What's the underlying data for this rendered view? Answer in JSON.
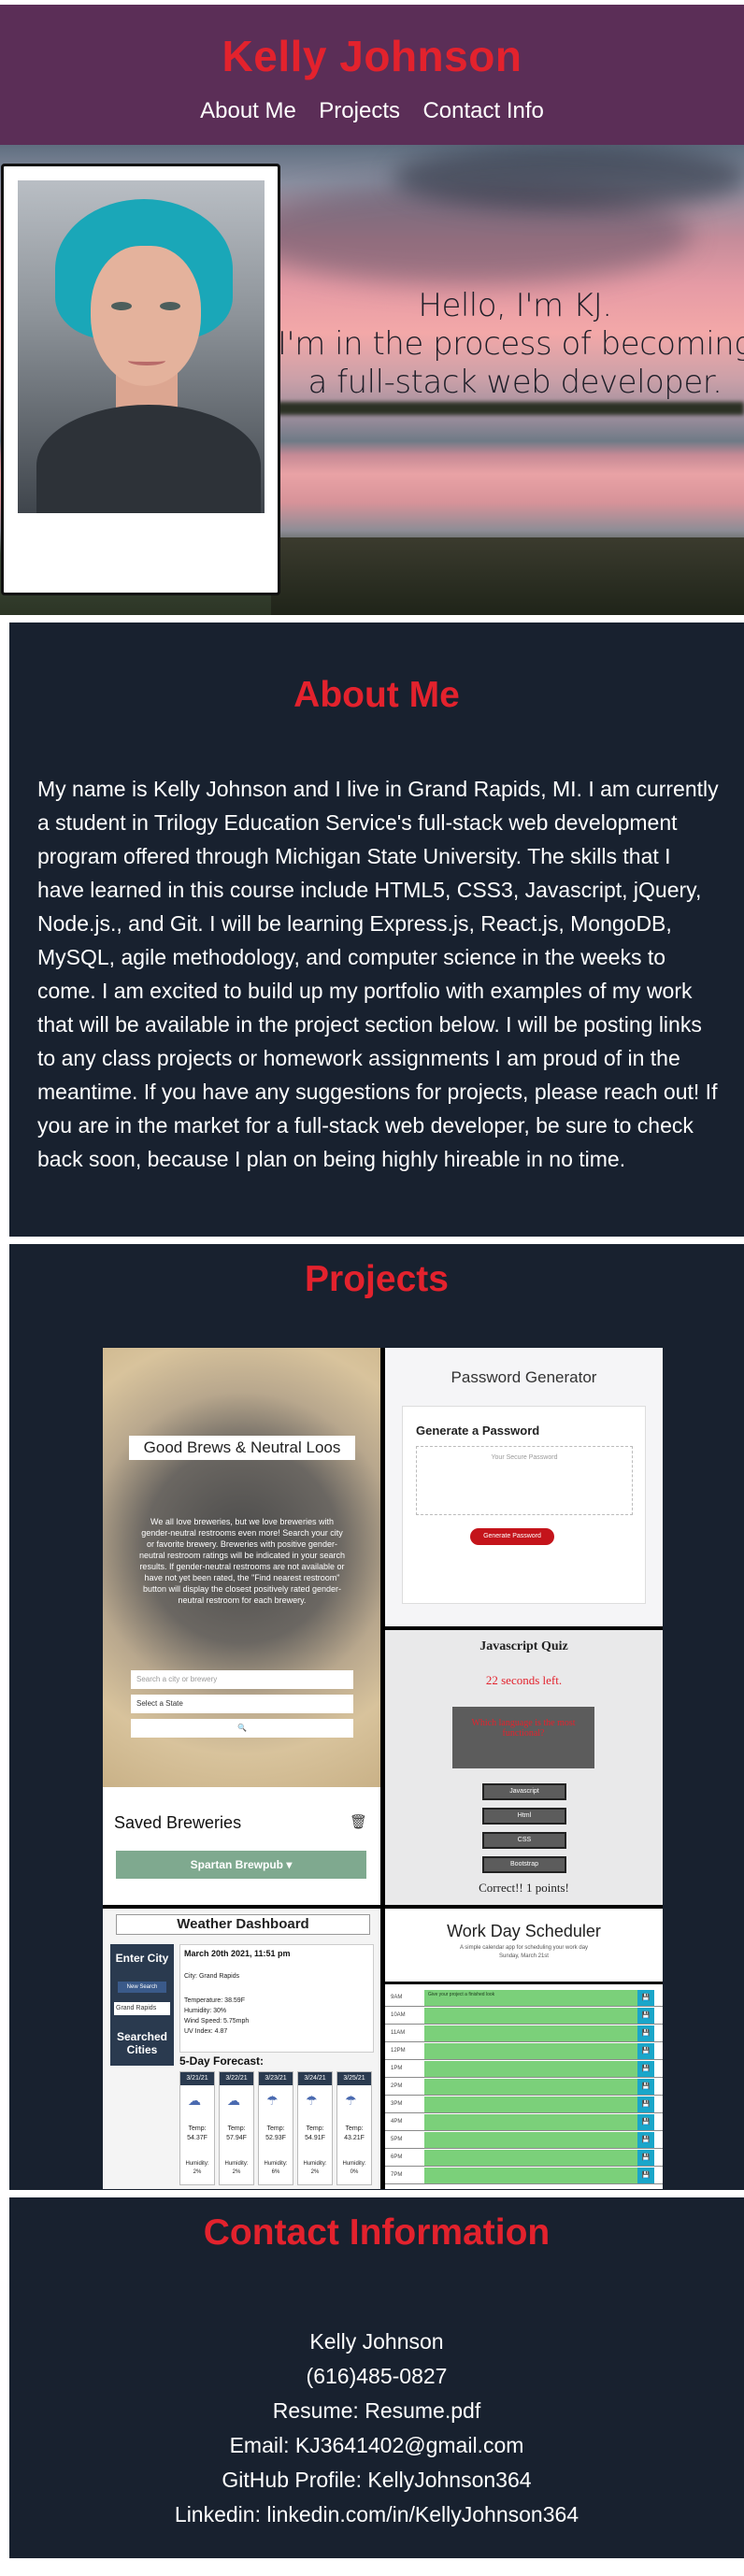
{
  "header": {
    "title": "Kelly Johnson",
    "nav": [
      "About Me",
      "Projects",
      "Contact Info"
    ]
  },
  "hero": {
    "line1": "Hello, I'm KJ.",
    "line2": "I'm in the process of becoming",
    "line3": "a full-stack web developer."
  },
  "about": {
    "title": "About Me",
    "text": "My name is Kelly Johnson and I live in Grand Rapids, MI. I am currently a student in Trilogy Education Service's full-stack web development program offered through Michigan State University. The skills that I have learned in this course include HTML5, CSS3, Javascript, jQuery, Node.js., and Git. I will be learning Express.js, React.js, MongoDB, MySQL, agile methodology, and computer science in the weeks to come. I am excited to build up my portfolio with examples of my work that will be available in the project section below. I will be posting links to any class projects or homework assignments I am proud of in the meantime. If you have any suggestions for projects, please reach out! If you are in the market for a full-stack web developer, be sure to check back soon, because I plan on being highly hireable in no time."
  },
  "projects": {
    "title": "Projects",
    "brewery": {
      "title": "Good Brews & Neutral Loos",
      "desc": "We all love breweries, but we love breweries with gender-neutral restrooms even more! Search your city or favorite brewery. Breweries with positive gender-neutral restroom ratings will be indicated in your search results. If gender-neutral restrooms are not available or have not yet been rated, the \"Find nearest restroom\" button will display the closest positively rated gender-neutral restroom for each brewery.",
      "search_placeholder": "Search a city or brewery",
      "state_select": "Select a State",
      "search_icon": "🔍",
      "saved_title": "Saved Breweries",
      "saved_item": "Spartan Brewpub"
    },
    "password": {
      "title": "Password Generator",
      "subtitle": "Generate a Password",
      "placeholder": "Your Secure Password",
      "button": "Generate Password"
    },
    "quiz": {
      "title": "Javascript Quiz",
      "timer": "22 seconds left.",
      "question": "Which language is the most functional?",
      "options": [
        "Javascript",
        "Html",
        "CSS",
        "Bootstrap"
      ],
      "result": "Correct!! 1 points!"
    },
    "weather": {
      "title": "Weather Dashboard",
      "enter_city": "Enter City",
      "new_search": "New Search",
      "city_item": "Grand Rapids",
      "searched": "Searched Cities",
      "date": "March 20th 2021, 11:51 pm",
      "city": "City: Grand Rapids",
      "temp": "Temperature: 38.59F",
      "humidity": "Humidity: 30%",
      "wind": "Wind Speed: 5.75mph",
      "uv": "UV Index: 4.87",
      "forecast_label": "5-Day Forecast:",
      "days": [
        {
          "date": "3/21/21",
          "temp": "54.37F",
          "hum": "2%"
        },
        {
          "date": "3/22/21",
          "temp": "57.94F",
          "hum": "2%"
        },
        {
          "date": "3/23/21",
          "temp": "52.93F",
          "hum": "6%"
        },
        {
          "date": "3/24/21",
          "temp": "54.91F",
          "hum": "2%"
        },
        {
          "date": "3/25/21",
          "temp": "43.21F",
          "hum": "0%"
        }
      ]
    },
    "scheduler": {
      "title": "Work Day Scheduler",
      "subtitle": "A simple calendar app for scheduling your work day",
      "date": "Sunday, March 21st",
      "hours": [
        "9AM",
        "10AM",
        "11AM",
        "12PM",
        "1PM",
        "2PM",
        "3PM",
        "4PM",
        "5PM",
        "6PM",
        "7PM"
      ],
      "first_entry": "Give your project a finished look"
    }
  },
  "contact": {
    "title": "Contact Information",
    "name": "Kelly Johnson",
    "phone": "(616)485-0827",
    "resume": "Resume: Resume.pdf",
    "email": "Email: KJ3641402@gmail.com",
    "github": "GitHub Profile: KellyJohnson364",
    "linkedin": "Linkedin: linkedin.com/in/KellyJohnson364"
  }
}
